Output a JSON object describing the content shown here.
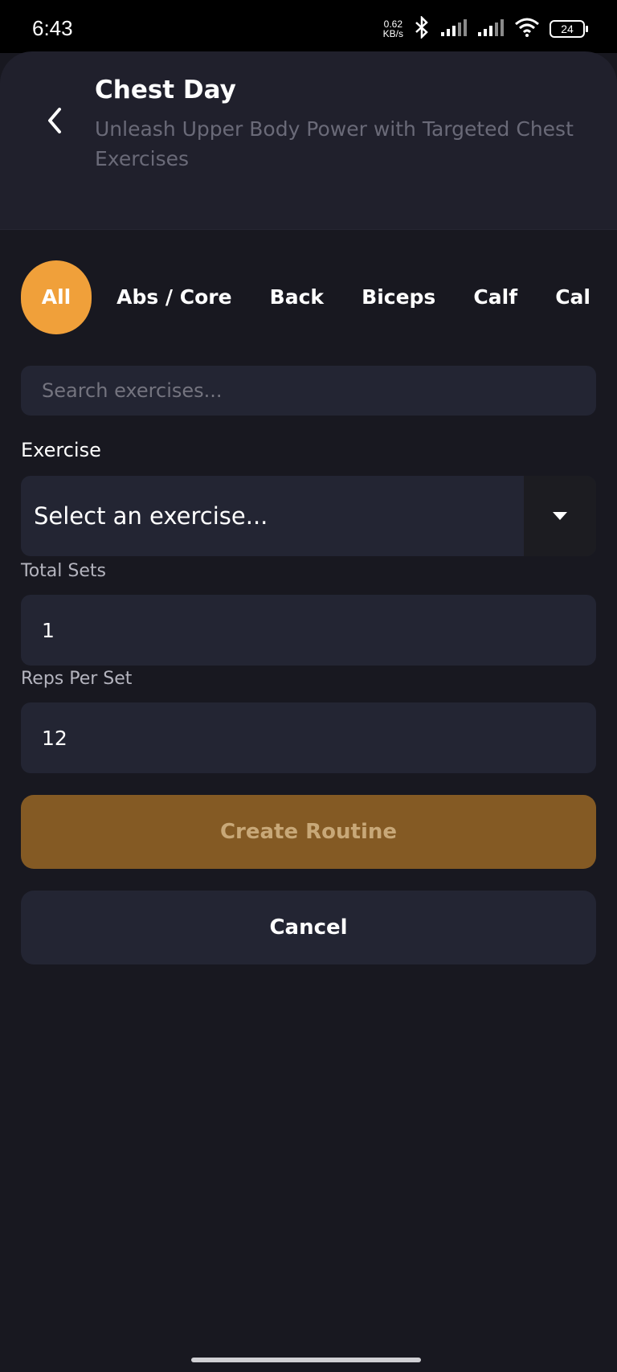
{
  "status_bar": {
    "time": "6:43",
    "net_speed_value": "0.62",
    "net_speed_unit": "KB/s",
    "battery": "24",
    "icons": [
      "bluetooth-icon",
      "signal-icon",
      "signal-icon",
      "wifi-icon",
      "battery-icon"
    ]
  },
  "header": {
    "title": "Chest Day",
    "subtitle": "Unleash Upper Body Power with Targeted Chest Exercises"
  },
  "categories": {
    "selected": "All",
    "items": [
      "All",
      "Abs / Core",
      "Back",
      "Biceps",
      "Calf",
      "Cal"
    ]
  },
  "search": {
    "placeholder": "Search exercises...",
    "value": ""
  },
  "form": {
    "exercise_label": "Exercise",
    "exercise_select_value": "Select an exercise...",
    "total_sets_label": "Total Sets",
    "total_sets_value": "1",
    "reps_label": "Reps Per Set",
    "reps_value": "12"
  },
  "actions": {
    "create_label": "Create Routine",
    "cancel_label": "Cancel"
  },
  "colors": {
    "background": "#181820",
    "header": "#20202c",
    "accent": "#f0a03a",
    "primary_button": "#845a24",
    "field": "#232533"
  }
}
